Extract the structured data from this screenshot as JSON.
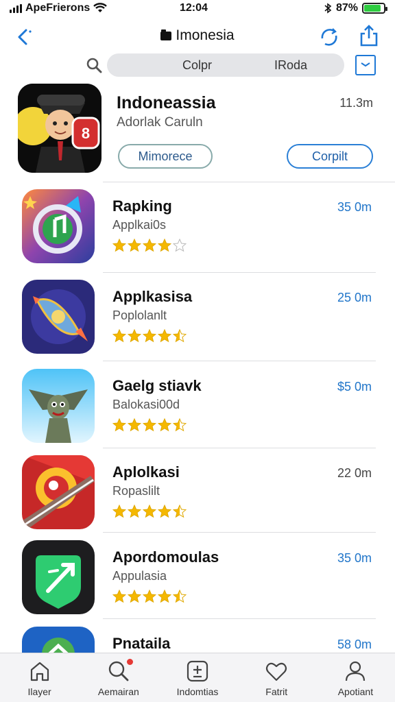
{
  "status_bar": {
    "carrier": "ApeFrierons",
    "time": "12:04",
    "battery": "87%",
    "battery_level": 0.87
  },
  "nav": {
    "title": "Imonesia"
  },
  "search": {
    "segment_a": "Colpr",
    "segment_b": "IRoda"
  },
  "featured": {
    "title": "Indoneassia",
    "subtitle": "Adorlak Caruln",
    "size": "11.3m",
    "button_left": "Mimorece",
    "button_right": "Corpilt"
  },
  "apps": [
    {
      "name": "Rapking",
      "subtitle": "Applkai0s",
      "size": "35 0m",
      "rating": 4,
      "size_color": "#2075c9"
    },
    {
      "name": "Applkasisa",
      "subtitle": "Poplolanlt",
      "size": "25 0m",
      "rating": 4.5,
      "size_color": "#2075c9"
    },
    {
      "name": "Gaelg stiavk",
      "subtitle": "Balokasi00d",
      "size": "$5 0m",
      "rating": 4.5,
      "size_color": "#2075c9"
    },
    {
      "name": "Aplolkasi",
      "subtitle": "Ropaslilt",
      "size": "22 0m",
      "rating": 4.5,
      "size_color": "#444444"
    },
    {
      "name": "Apordomoulas",
      "subtitle": "Appulasia",
      "size": "35 0m",
      "rating": 4.5,
      "size_color": "#2075c9"
    },
    {
      "name": "Pnataila",
      "subtitle": "",
      "size": "58 0m",
      "rating": 0,
      "size_color": "#2075c9"
    }
  ],
  "tabs": [
    {
      "label": "Ilayer",
      "icon": "home-icon"
    },
    {
      "label": "Aemairan",
      "icon": "search-icon"
    },
    {
      "label": "Indomtias",
      "icon": "plus-box-icon"
    },
    {
      "label": "Fatrit",
      "icon": "heart-icon"
    },
    {
      "label": "Apotiant",
      "icon": "person-icon"
    }
  ]
}
